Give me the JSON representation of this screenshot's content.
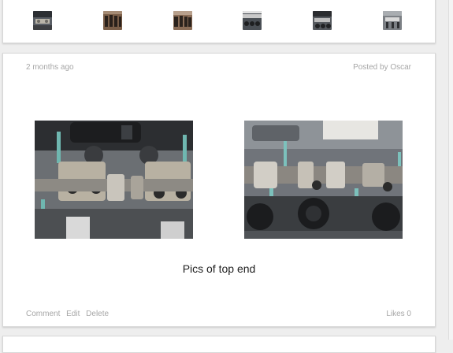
{
  "gallery_thumbnails": [
    {
      "name": "thumbnail-engine-1"
    },
    {
      "name": "thumbnail-engine-2"
    },
    {
      "name": "thumbnail-engine-3"
    },
    {
      "name": "thumbnail-engine-4"
    },
    {
      "name": "thumbnail-engine-5"
    },
    {
      "name": "thumbnail-engine-6"
    }
  ],
  "post": {
    "timestamp": "2 months ago",
    "author": "Posted by Oscar",
    "caption": "Pics of top end",
    "actions": {
      "comment": "Comment",
      "edit": "Edit",
      "delete": "Delete"
    },
    "likes": "Likes 0"
  },
  "colors": {
    "page_bg": "#eeeeee",
    "card_bg": "#ffffff",
    "meta_text": "#a6a6a6",
    "caption_text": "#222222"
  }
}
